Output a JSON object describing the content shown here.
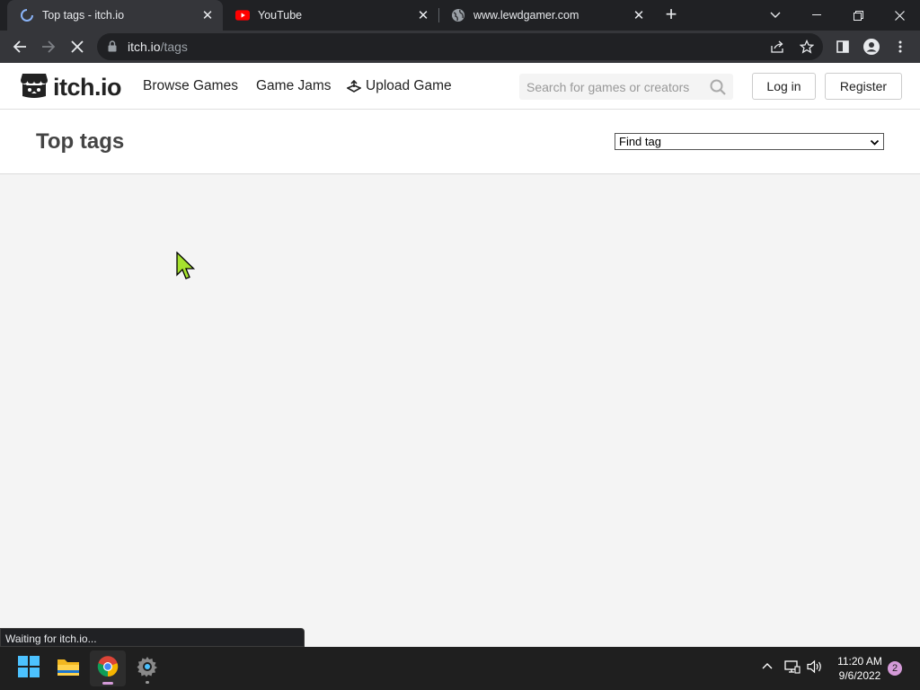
{
  "browser": {
    "tabs": [
      {
        "title": "Top tags - itch.io",
        "favicon": "loading-spinner-icon",
        "active": true
      },
      {
        "title": "YouTube",
        "favicon": "youtube-icon",
        "active": false
      },
      {
        "title": "www.lewdgamer.com",
        "favicon": "globe-icon",
        "active": false
      }
    ],
    "url_domain": "itch.io",
    "url_path": "/tags",
    "status_text": "Waiting for itch.io..."
  },
  "site": {
    "logo_text": "itch.io",
    "nav": {
      "browse": "Browse Games",
      "jams": "Game Jams",
      "upload": "Upload Game"
    },
    "search_placeholder": "Search for games or creators",
    "login": "Log in",
    "register": "Register"
  },
  "page": {
    "title": "Top tags",
    "find_tag_selected": "Find tag"
  },
  "taskbar": {
    "time": "11:20 AM",
    "date": "9/6/2022",
    "notification_count": "2"
  },
  "colors": {
    "chrome_dark": "#202124",
    "chrome_toolbar": "#35363a",
    "page_bg": "#f4f4f4",
    "taskbar": "#1f1f1f",
    "accent_pink": "#d49ad8",
    "youtube_red": "#ff0000"
  }
}
